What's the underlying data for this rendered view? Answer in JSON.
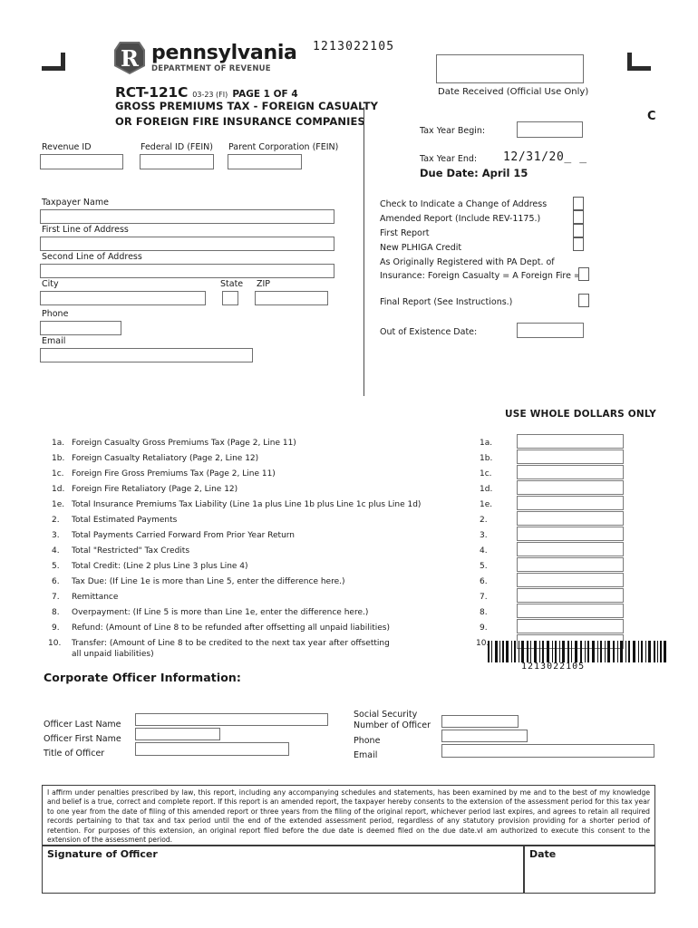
{
  "document": {
    "form_number": "RCT-121C",
    "revision": "03-23 (FI)",
    "page_of": "PAGE 1 OF 4",
    "title_line1": "GROSS PREMIUMS TAX - FOREIGN CASUALTY",
    "title_line2": "OR FOREIGN FIRE INSURANCE COMPANIES",
    "form_code_top": "1213022105",
    "corner_letter": "C"
  },
  "agency": {
    "name": "pennsylvania",
    "department": "DEPARTMENT OF REVENUE",
    "logo_letter": "R"
  },
  "official_use": {
    "date_received_label": "Date Received (Official Use Only)",
    "date_received_value": ""
  },
  "tax_year": {
    "begin_label": "Tax Year Begin:",
    "begin_value": "",
    "end_label": "Tax Year End:",
    "end_value": "12/31/20_ _",
    "due_date": "Due Date: April 15"
  },
  "identification": {
    "revenue_id_label": "Revenue ID",
    "revenue_id_value": "",
    "federal_id_label": "Federal ID (FEIN)",
    "federal_id_value": "",
    "parent_corp_label": "Parent Corporation (FEIN)",
    "parent_corp_value": ""
  },
  "taxpayer": {
    "name_label": "Taxpayer Name",
    "name_value": "",
    "address1_label": "First Line of Address",
    "address1_value": "",
    "address2_label": "Second Line of Address",
    "address2_value": "",
    "city_label": "City",
    "city_value": "",
    "state_label": "State",
    "state_value": "",
    "zip_label": "ZIP",
    "zip_value": "",
    "phone_label": "Phone",
    "phone_value": "",
    "email_label": "Email",
    "email_value": ""
  },
  "checkboxes": [
    {
      "label": "Check to Indicate a Change of Address",
      "checked": false
    },
    {
      "label": "Amended Report (Include REV-1175.)",
      "checked": false
    },
    {
      "label": "First Report",
      "checked": false
    },
    {
      "label": "New PLHIGA Credit",
      "checked": false
    }
  ],
  "registration": {
    "line1": "As Originally Registered with PA Dept. of",
    "line2": "Insurance: Foreign Casualty = A   Foreign Fire = B",
    "value": "",
    "checked": false
  },
  "final_report": {
    "label": "Final Report (See Instructions.)",
    "checked": false
  },
  "out_of_existence": {
    "label": "Out of Existence Date:",
    "value": ""
  },
  "amounts_header": "USE WHOLE DOLLARS ONLY",
  "line_items": [
    {
      "num": "1a.",
      "desc": "Foreign Casualty Gross Premiums Tax (Page 2, Line 11)",
      "amount": ""
    },
    {
      "num": "1b.",
      "desc": "Foreign Casualty Retaliatory (Page 2, Line 12)",
      "amount": ""
    },
    {
      "num": "1c.",
      "desc": "Foreign Fire Gross Premiums Tax (Page 2, Line 11)",
      "amount": ""
    },
    {
      "num": "1d.",
      "desc": "Foreign Fire Retaliatory (Page 2, Line 12)",
      "amount": ""
    },
    {
      "num": "1e.",
      "desc": "Total Insurance Premiums Tax Liability (Line 1a plus Line 1b plus Line 1c plus Line 1d)",
      "amount": ""
    },
    {
      "num": "2.",
      "desc": "Total Estimated Payments",
      "amount": ""
    },
    {
      "num": "3.",
      "desc": "Total Payments Carried Forward From Prior Year Return",
      "amount": ""
    },
    {
      "num": "4.",
      "desc": "Total \"Restricted\" Tax Credits",
      "amount": ""
    },
    {
      "num": "5.",
      "desc": "Total Credit: (Line 2 plus Line 3 plus Line 4)",
      "amount": ""
    },
    {
      "num": "6.",
      "desc": "Tax Due: (If Line 1e is more than Line 5, enter the difference here.)",
      "amount": ""
    },
    {
      "num": "7.",
      "desc": "Remittance",
      "amount": ""
    },
    {
      "num": "8.",
      "desc": "Overpayment: (If Line 5 is more than Line 1e, enter the difference here.)",
      "amount": ""
    },
    {
      "num": "9.",
      "desc": "Refund: (Amount of Line 8 to be refunded after offsetting all unpaid liabilities)",
      "amount": ""
    },
    {
      "num": "10.",
      "desc": "Transfer: (Amount of Line 8 to be credited to the next tax year after offsetting",
      "desc2": "all unpaid liabilities)",
      "amount": ""
    }
  ],
  "barcode": {
    "value": "1213022105"
  },
  "officer_section": {
    "heading": "Corporate Officer Information:",
    "last_name_label": "Officer Last Name",
    "last_name_value": "",
    "first_name_label": "Officer First Name",
    "first_name_value": "",
    "title_label": "Title of Officer",
    "title_value": "",
    "ssn_label_line1": "Social Security",
    "ssn_label_line2": "Number of Officer",
    "ssn_value": "",
    "phone_label": "Phone",
    "phone_value": "",
    "email_label": "Email",
    "email_value": ""
  },
  "affirmation": {
    "text": "I affirm under penalties prescribed by law, this report, including any accompanying schedules and statements, has been examined by me and to the best of my knowledge and belief is a true, correct and complete report. If this report is an amended report, the taxpayer hereby consents to the extension of the assessment period for this tax year to one year from the date of filing of this amended report or three years from the filing of the original report, whichever period last expires, and agrees to retain all required records pertaining to that tax and tax period until the end of the extended assessment period, regardless of any statutory provision providing for a shorter period of retention. For purposes of this extension, an original report filed before the due date is deemed filed on the due date.vI am authorized to execute this consent to the extension of the assessment period.",
    "signature_label": "Signature of Officer",
    "signature_value": "",
    "date_label": "Date",
    "date_value": ""
  }
}
